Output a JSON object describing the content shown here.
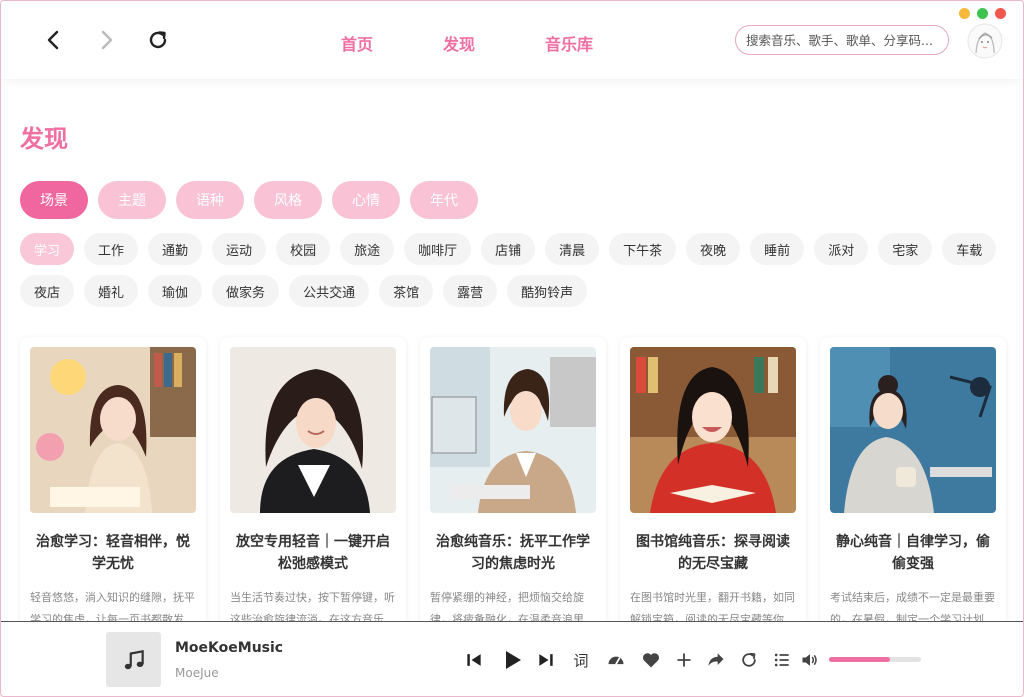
{
  "header": {
    "tabs": [
      {
        "label": "首页"
      },
      {
        "label": "发现"
      },
      {
        "label": "音乐库"
      }
    ],
    "search_placeholder": "搜索音乐、歌手、歌单、分享码..."
  },
  "window_controls": {
    "colors": [
      "#f5b93b",
      "#3fc34f",
      "#f0574f"
    ]
  },
  "page": {
    "title": "发现",
    "categories": [
      "场景",
      "主题",
      "语种",
      "风格",
      "心情",
      "年代"
    ],
    "active_category": "场景",
    "tags_row1": [
      "学习",
      "工作",
      "通勤",
      "运动",
      "校园",
      "旅途",
      "咖啡厅",
      "店铺",
      "清晨",
      "下午茶",
      "夜晚",
      "睡前",
      "派对",
      "宅家",
      "车载"
    ],
    "tags_row2": [
      "夜店",
      "婚礼",
      "瑜伽",
      "做家务",
      "公共交通",
      "茶馆",
      "露营",
      "酷狗铃声"
    ],
    "active_tag": "学习"
  },
  "cards": [
    {
      "title": "治愈学习：轻音相伴，悦学无忧",
      "desc": "轻音悠悠，淌入知识的缝隙，抚平学习的焦虑，让每一页书都散发..."
    },
    {
      "title": "放空专用轻音｜一键开启松弛感模式",
      "desc": "当生活节奏过快，按下暂停键，听这些治愈旋律流淌。在这方音乐..."
    },
    {
      "title": "治愈纯音乐：抚平工作学习的焦虑时光",
      "desc": "暂停紧绷的神经，把烦恼交给旋律，将疲惫融化，在温柔音浪里..."
    },
    {
      "title": "图书馆纯音乐：探寻阅读的无尽宝藏",
      "desc": "在图书馆时光里，翻开书籍，如同解锁宝箱，阅读的无尽宝藏等你..."
    },
    {
      "title": "静心纯音｜自律学习，偷偷变强",
      "desc": "考试结束后，成绩不一定是最重要的，在暑假，制定一个学习计划..."
    }
  ],
  "player": {
    "title": "MoeKoeMusic",
    "artist": "MoeJue",
    "lyric_label": "词",
    "volume_percent": 66,
    "accent": "#f06fa3"
  }
}
